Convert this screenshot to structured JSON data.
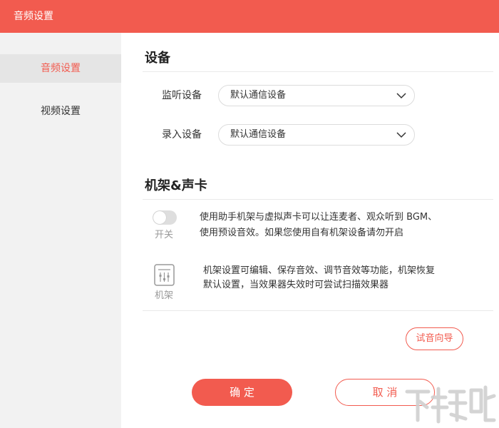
{
  "window": {
    "title": "音频设置"
  },
  "sidebar": {
    "items": [
      {
        "label": "音频设置",
        "active": true
      },
      {
        "label": "视频设置",
        "active": false
      }
    ]
  },
  "devices": {
    "heading": "设备",
    "monitor": {
      "label": "监听设备",
      "value": "默认通信设备"
    },
    "record": {
      "label": "录入设备",
      "value": "默认通信设备"
    }
  },
  "rack": {
    "heading": "机架&声卡",
    "switch": {
      "caption": "开关",
      "on": false,
      "desc_line1": "使用助手机架与虚拟声卡可以让连麦者、观众听到 BGM、",
      "desc_line2": "使用预设音效。如果您使用自有机架设备请勿开启"
    },
    "rack_item": {
      "caption": "机架",
      "icon": "rack-icon",
      "desc_line1": "机架设置可编辑、保存音效、调节音效等功能，机架恢复",
      "desc_line2": "默认设置，当效果器失效时可尝试扫描效果器"
    },
    "guide_button": "试音向导"
  },
  "footer": {
    "ok": "确 定",
    "cancel": "取 消"
  },
  "watermark": {
    "text": "下载吧"
  },
  "colors": {
    "accent": "#f25b4f",
    "sidebar_bg": "#f2f2f2",
    "sidebar_active_bg": "#e5e5e5"
  }
}
